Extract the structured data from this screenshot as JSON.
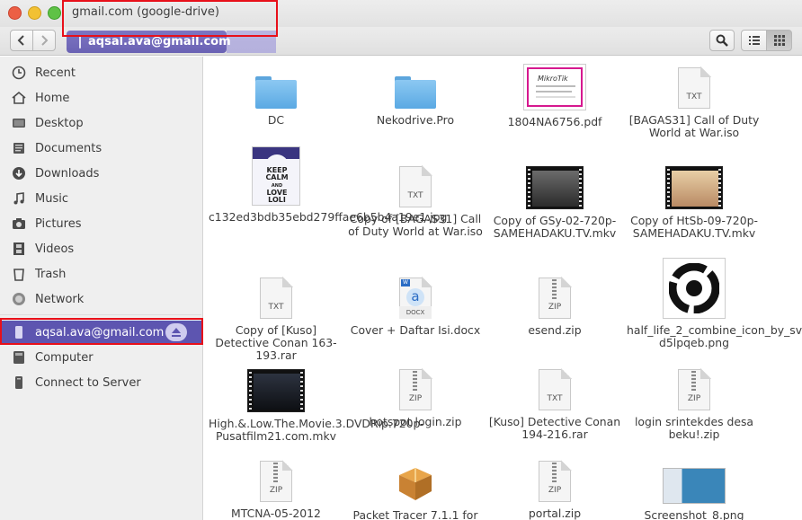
{
  "window": {
    "title": "gmail.com (google-drive)"
  },
  "toolbar": {
    "path_label": "aqsal.ava@gmail.com"
  },
  "sidebar": {
    "items": [
      {
        "label": "Recent",
        "icon": "clock-icon"
      },
      {
        "label": "Home",
        "icon": "home-icon"
      },
      {
        "label": "Desktop",
        "icon": "desktop-icon"
      },
      {
        "label": "Documents",
        "icon": "documents-icon"
      },
      {
        "label": "Downloads",
        "icon": "download-icon"
      },
      {
        "label": "Music",
        "icon": "music-icon"
      },
      {
        "label": "Pictures",
        "icon": "camera-icon"
      },
      {
        "label": "Videos",
        "icon": "film-icon"
      },
      {
        "label": "Trash",
        "icon": "trash-icon"
      },
      {
        "label": "Network",
        "icon": "network-icon"
      }
    ],
    "mounts": [
      {
        "label": "aqsal.ava@gmail.com",
        "icon": "drive-icon",
        "selected": true
      },
      {
        "label": "Computer",
        "icon": "computer-icon"
      },
      {
        "label": "Connect to Server",
        "icon": "server-icon"
      }
    ]
  },
  "files": [
    {
      "name": "DC",
      "kind": "folder"
    },
    {
      "name": "Nekodrive.Pro",
      "kind": "folder"
    },
    {
      "name": "1804NA6756.pdf",
      "kind": "pdf",
      "thumb_text": "MikroTik"
    },
    {
      "name": "[BAGAS31] Call of Duty World at War.iso",
      "kind": "doc",
      "ext": "TXT"
    },
    {
      "name": "c132ed3bdb35ebd279ffae6b5b4a19e1.jpg",
      "kind": "keepcalm",
      "thumb_lines": [
        "KEEP",
        "CALM",
        "AND",
        "LOVE",
        "LOLI"
      ]
    },
    {
      "name": "Copy of [BAGAS31] Call of Duty World at War.iso",
      "kind": "doc",
      "ext": "TXT"
    },
    {
      "name": "Copy of GSy-02-720p-SAMEHADAKU.TV.mkv",
      "kind": "video"
    },
    {
      "name": "Copy of HtSb-09-720p-SAMEHADAKU.TV.mkv",
      "kind": "video"
    },
    {
      "name": "Copy of [Kuso] Detective Conan 163-193.rar",
      "kind": "doc",
      "ext": "TXT"
    },
    {
      "name": "Cover + Daftar Isi.docx",
      "kind": "docx",
      "ext": "DOCX"
    },
    {
      "name": "esend.zip",
      "kind": "zip",
      "ext": "ZIP"
    },
    {
      "name": "half_life_2_combine_icon_by_sveencoop-d5lpqeb.png",
      "kind": "halflife"
    },
    {
      "name": "High.&.Low.The.Movie.3.DVDRip.720p-Pusatfilm21.com.mkv",
      "kind": "video"
    },
    {
      "name": "hotspot login.zip",
      "kind": "zip",
      "ext": "ZIP"
    },
    {
      "name": "[Kuso] Detective Conan 194-216.rar",
      "kind": "doc",
      "ext": "TXT"
    },
    {
      "name": "login srintekdes desa beku!.zip",
      "kind": "zip",
      "ext": "ZIP"
    },
    {
      "name": "MTCNA-05-2012",
      "kind": "zip",
      "ext": "ZIP"
    },
    {
      "name": "Packet Tracer 7.1.1 for",
      "kind": "package"
    },
    {
      "name": "portal.zip",
      "kind": "zip",
      "ext": "ZIP"
    },
    {
      "name": "Screenshot_8.png",
      "kind": "screenshot"
    }
  ],
  "colors": {
    "accent": "#5d55b0",
    "highlight": "#e8101a",
    "folder": "#6fb6ea"
  }
}
